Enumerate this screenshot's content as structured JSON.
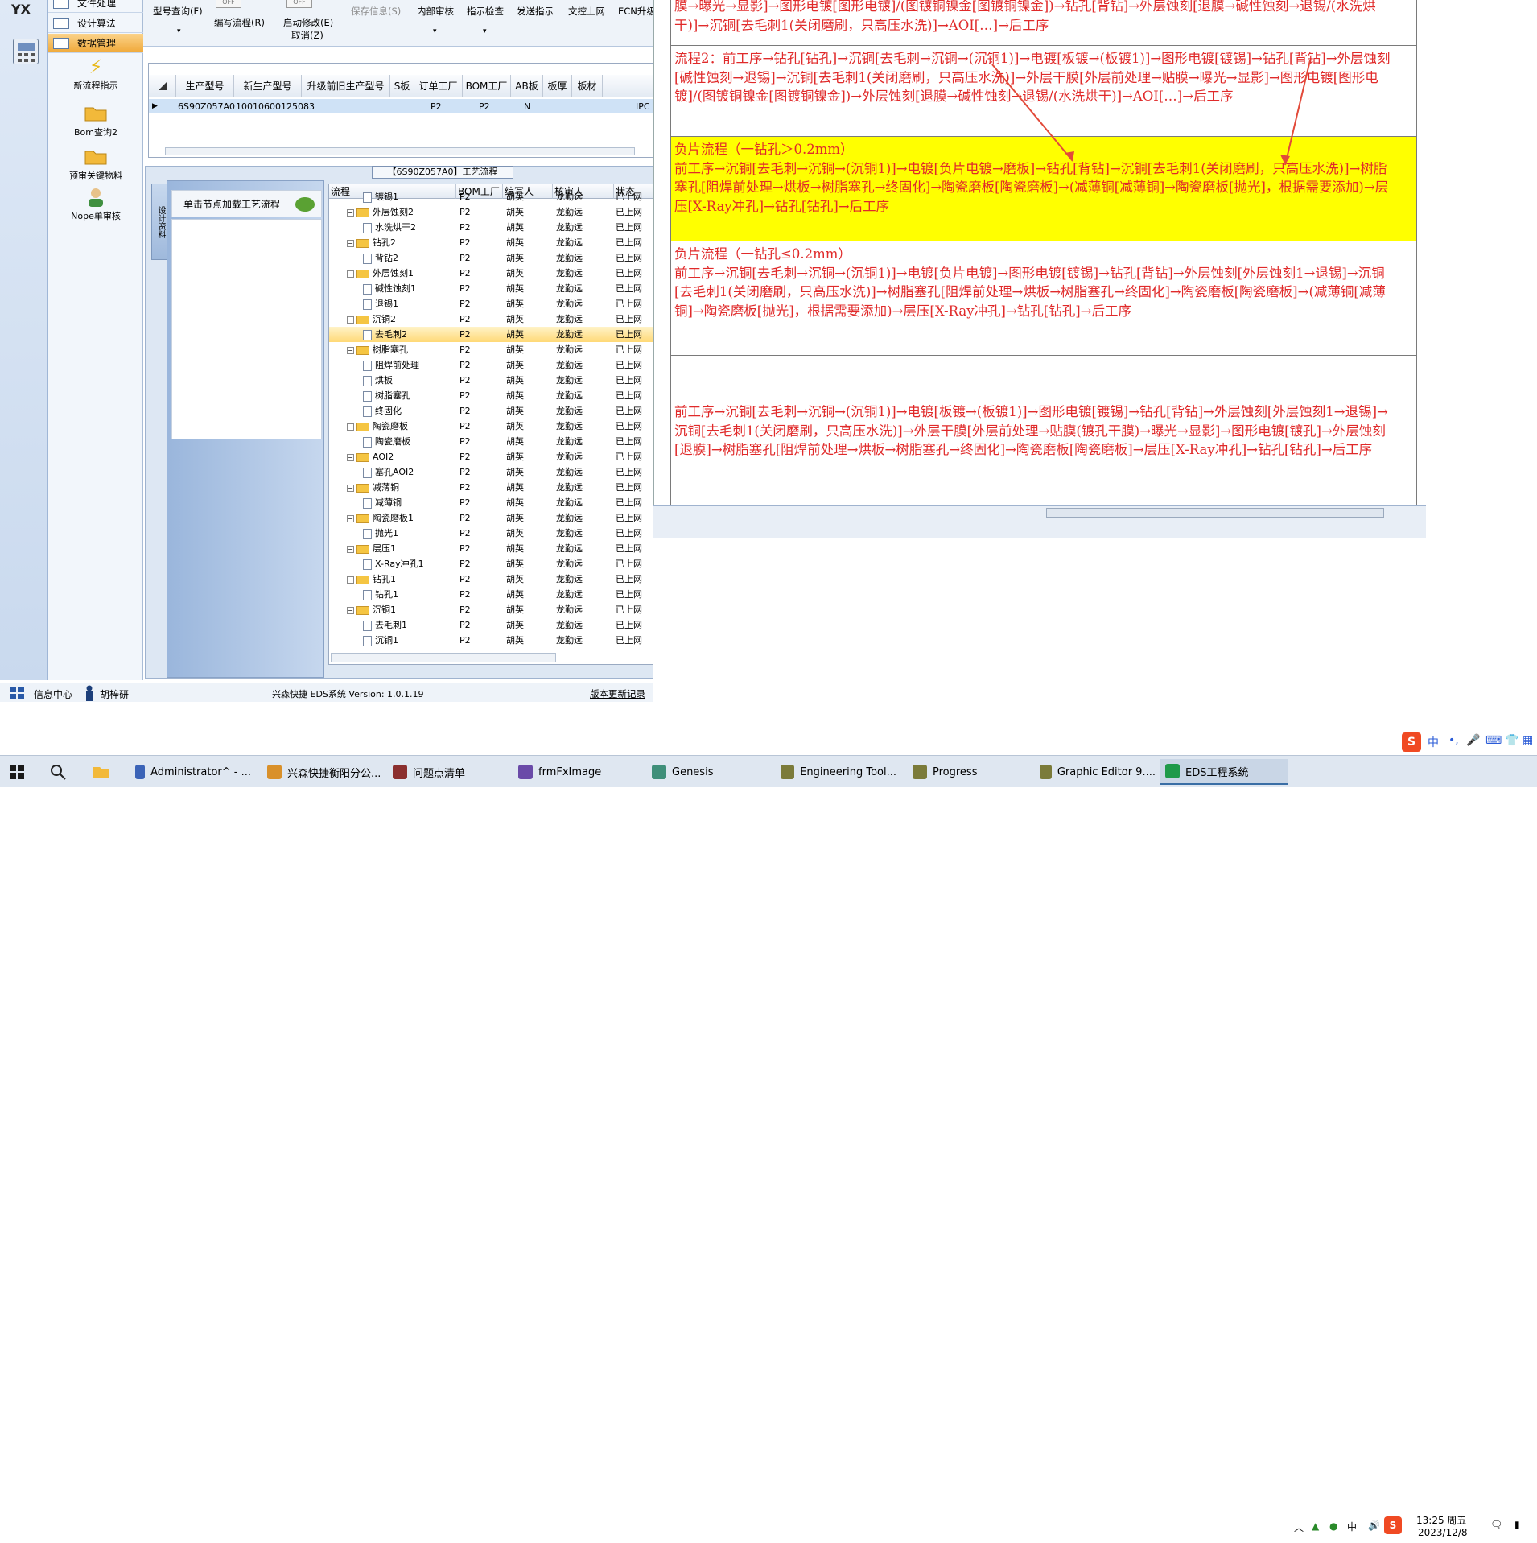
{
  "left_rail": {
    "logo_text": "YX"
  },
  "nav": {
    "items": [
      {
        "label": "文件处理"
      },
      {
        "label": "设计算法"
      },
      {
        "label": "数据管理"
      }
    ],
    "tools": [
      {
        "label": "新流程指示"
      },
      {
        "label": "Bom查询2"
      },
      {
        "label": "预审关键物料"
      },
      {
        "label": "Nope单审核"
      }
    ]
  },
  "toolbar": {
    "model_query": "型号查询(F)",
    "edit_flow": "编写流程(R)",
    "start_modify": "启动修改(E)",
    "cancel": "取消(Z)",
    "save_info": "保存信息(S)",
    "internal_review": "内部审核",
    "indicator_check": "指示检查",
    "send_indicator": "发送指示",
    "doc_upload": "文控上网",
    "ecn_upgrade": "ECN升级",
    "toggle_off_1": "OFF",
    "toggle_off_2": "OFF"
  },
  "top_grid": {
    "headers": [
      "生产型号",
      "新生产型号",
      "升级前旧生产型号",
      "S板",
      "订单工厂",
      "BOM工厂",
      "AB板",
      "板厚",
      "板材"
    ],
    "row": [
      "6S90Z057A0",
      "10010600125083",
      "",
      "",
      "P2",
      "P2",
      "N",
      "",
      "",
      "IPC"
    ]
  },
  "process": {
    "title": "【6S90Z057A0】工艺流程",
    "side_tab": "设计资料",
    "load_button": "单击节点加载工艺流程",
    "columns": [
      "流程",
      "BOM工厂",
      "编写人",
      "核审人",
      "状态"
    ],
    "rows": [
      {
        "name": "镀锡1",
        "level": 2,
        "bom": "P2",
        "writer": "胡英",
        "reviewer": "龙勤远",
        "status": "已上网"
      },
      {
        "name": "外层蚀刻2",
        "level": 1,
        "bom": "P2",
        "writer": "胡英",
        "reviewer": "龙勤远",
        "status": "已上网"
      },
      {
        "name": "水洗烘干2",
        "level": 2,
        "bom": "P2",
        "writer": "胡英",
        "reviewer": "龙勤远",
        "status": "已上网"
      },
      {
        "name": "钻孔2",
        "level": 1,
        "bom": "P2",
        "writer": "胡英",
        "reviewer": "龙勤远",
        "status": "已上网"
      },
      {
        "name": "背钻2",
        "level": 2,
        "bom": "P2",
        "writer": "胡英",
        "reviewer": "龙勤远",
        "status": "已上网"
      },
      {
        "name": "外层蚀刻1",
        "level": 1,
        "bom": "P2",
        "writer": "胡英",
        "reviewer": "龙勤远",
        "status": "已上网"
      },
      {
        "name": "碱性蚀刻1",
        "level": 2,
        "bom": "P2",
        "writer": "胡英",
        "reviewer": "龙勤远",
        "status": "已上网"
      },
      {
        "name": "退锡1",
        "level": 2,
        "bom": "P2",
        "writer": "胡英",
        "reviewer": "龙勤远",
        "status": "已上网"
      },
      {
        "name": "沉铜2",
        "level": 1,
        "bom": "P2",
        "writer": "胡英",
        "reviewer": "龙勤远",
        "status": "已上网"
      },
      {
        "name": "去毛刺2",
        "level": 2,
        "bom": "P2",
        "writer": "胡英",
        "reviewer": "龙勤远",
        "status": "已上网",
        "selected": true
      },
      {
        "name": "树脂塞孔",
        "level": 1,
        "bom": "P2",
        "writer": "胡英",
        "reviewer": "龙勤远",
        "status": "已上网"
      },
      {
        "name": "阻焊前处理",
        "level": 2,
        "bom": "P2",
        "writer": "胡英",
        "reviewer": "龙勤远",
        "status": "已上网"
      },
      {
        "name": "烘板",
        "level": 2,
        "bom": "P2",
        "writer": "胡英",
        "reviewer": "龙勤远",
        "status": "已上网"
      },
      {
        "name": "树脂塞孔",
        "level": 2,
        "bom": "P2",
        "writer": "胡英",
        "reviewer": "龙勤远",
        "status": "已上网"
      },
      {
        "name": "终固化",
        "level": 2,
        "bom": "P2",
        "writer": "胡英",
        "reviewer": "龙勤远",
        "status": "已上网"
      },
      {
        "name": "陶瓷磨板",
        "level": 1,
        "bom": "P2",
        "writer": "胡英",
        "reviewer": "龙勤远",
        "status": "已上网"
      },
      {
        "name": "陶瓷磨板",
        "level": 2,
        "bom": "P2",
        "writer": "胡英",
        "reviewer": "龙勤远",
        "status": "已上网"
      },
      {
        "name": "AOI2",
        "level": 1,
        "bom": "P2",
        "writer": "胡英",
        "reviewer": "龙勤远",
        "status": "已上网"
      },
      {
        "name": "塞孔AOI2",
        "level": 2,
        "bom": "P2",
        "writer": "胡英",
        "reviewer": "龙勤远",
        "status": "已上网"
      },
      {
        "name": "减薄铜",
        "level": 1,
        "bom": "P2",
        "writer": "胡英",
        "reviewer": "龙勤远",
        "status": "已上网"
      },
      {
        "name": "减薄铜",
        "level": 2,
        "bom": "P2",
        "writer": "胡英",
        "reviewer": "龙勤远",
        "status": "已上网"
      },
      {
        "name": "陶瓷磨板1",
        "level": 1,
        "bom": "P2",
        "writer": "胡英",
        "reviewer": "龙勤远",
        "status": "已上网"
      },
      {
        "name": "抛光1",
        "level": 2,
        "bom": "P2",
        "writer": "胡英",
        "reviewer": "龙勤远",
        "status": "已上网"
      },
      {
        "name": "层压1",
        "level": 1,
        "bom": "P2",
        "writer": "胡英",
        "reviewer": "龙勤远",
        "status": "已上网"
      },
      {
        "name": "X-Ray冲孔1",
        "level": 2,
        "bom": "P2",
        "writer": "胡英",
        "reviewer": "龙勤远",
        "status": "已上网"
      },
      {
        "name": "钻孔1",
        "level": 1,
        "bom": "P2",
        "writer": "胡英",
        "reviewer": "龙勤远",
        "status": "已上网"
      },
      {
        "name": "钻孔1",
        "level": 2,
        "bom": "P2",
        "writer": "胡英",
        "reviewer": "龙勤远",
        "status": "已上网"
      },
      {
        "name": "沉铜1",
        "level": 1,
        "bom": "P2",
        "writer": "胡英",
        "reviewer": "龙勤远",
        "status": "已上网"
      },
      {
        "name": "去毛刺1",
        "level": 2,
        "bom": "P2",
        "writer": "胡英",
        "reviewer": "龙勤远",
        "status": "已上网"
      },
      {
        "name": "沉铜1",
        "level": 2,
        "bom": "P2",
        "writer": "胡英",
        "reviewer": "龙勤远",
        "status": "已上网"
      }
    ]
  },
  "status_bar": {
    "info_center": "信息中心",
    "user": "胡梓研",
    "version": "兴森快捷 EDS系统 Version: 1.0.1.19",
    "update_log": "版本更新记录"
  },
  "right_flows": [
    {
      "text": "膜→曝光→显影]→图形电镀[图形电镀]/(图镀铜镍金[图镀铜镍金])→钻孔[背钻]→外层蚀刻[退膜→碱性蚀刻→退锡/(水洗烘干)]→沉铜[去毛刺1(关闭磨刷，只高压水洗)]→AOI[…]→后工序"
    },
    {
      "text": "流程2：前工序→钻孔[钻孔]→沉铜[去毛刺→沉铜→(沉铜1)]→电镀[板镀→(板镀1)]→图形电镀[镀锡]→钻孔[背钻]→外层蚀刻[碱性蚀刻→退锡]→沉铜[去毛刺1(关闭磨刷，只高压水洗)]→外层干膜[外层前处理→贴膜→曝光→显影]→图形电镀[图形电镀]/(图镀铜镍金[图镀铜镍金])→外层蚀刻[退膜→碱性蚀刻→退锡/(水洗烘干)]→AOI[…]→后工序"
    },
    {
      "text": "负片流程（一钻孔＞0.2mm）\n前工序→沉铜[去毛刺→沉铜→(沉铜1)]→电镀[负片电镀→磨板]→钻孔[背钻]→沉铜[去毛刺1(关闭磨刷，只高压水洗)]→树脂塞孔[阻焊前处理→烘板→树脂塞孔→终固化]→陶瓷磨板[陶瓷磨板]→(减薄铜[减薄铜]→陶瓷磨板[抛光]，根据需要添加)→层压[X-Ray冲孔]→钻孔[钻孔]→后工序"
    },
    {
      "text": "负片流程（一钻孔≤0.2mm）\n前工序→沉铜[去毛刺→沉铜→(沉铜1)]→电镀[负片电镀]→图形电镀[镀锡]→钻孔[背钻]→外层蚀刻[外层蚀刻1→退锡]→沉铜[去毛刺1(关闭磨刷，只高压水洗)]→树脂塞孔[阻焊前处理→烘板→树脂塞孔→终固化]→陶瓷磨板[陶瓷磨板]→(减薄铜[减薄铜]→陶瓷磨板[抛光]，根据需要添加)→层压[X-Ray冲孔]→钻孔[钻孔]→后工序"
    },
    {
      "text": "前工序→沉铜[去毛刺→沉铜→(沉铜1)]→电镀[板镀→(板镀1)]→图形电镀[镀锡]→钻孔[背钻]→外层蚀刻[外层蚀刻1→退锡]→沉铜[去毛刺1(关闭磨刷，只高压水洗)]→外层干膜[外层前处理→贴膜(镀孔干膜)→曝光→显影]→图形电镀[镀孔]→外层蚀刻[退膜]→树脂塞孔[阻焊前处理→烘板→树脂塞孔→终固化]→陶瓷磨板[陶瓷磨板]→层压[X-Ray冲孔]→钻孔[钻孔]→后工序"
    }
  ],
  "taskbar": {
    "items": [
      {
        "label": "Administrator^ - ...",
        "color": "#3b63b7"
      },
      {
        "label": "兴森快捷衡阳分公...",
        "color": "#d9902a"
      },
      {
        "label": "问题点清单",
        "color": "#8b2f2f"
      },
      {
        "label": "frmFxImage",
        "color": "#6a4aa8"
      },
      {
        "label": "Genesis",
        "color": "#3f8f7a"
      },
      {
        "label": "Engineering Tool...",
        "color": "#7b7b3a"
      },
      {
        "label": "Progress",
        "color": "#7b7b3a"
      },
      {
        "label": "Graphic Editor 9....",
        "color": "#7b7b3a"
      },
      {
        "label": "EDS工程系统",
        "color": "#1e9a4a",
        "active": true
      }
    ],
    "clock_time": "13:25 周五",
    "clock_date": "2023/12/8",
    "ime": "中"
  }
}
